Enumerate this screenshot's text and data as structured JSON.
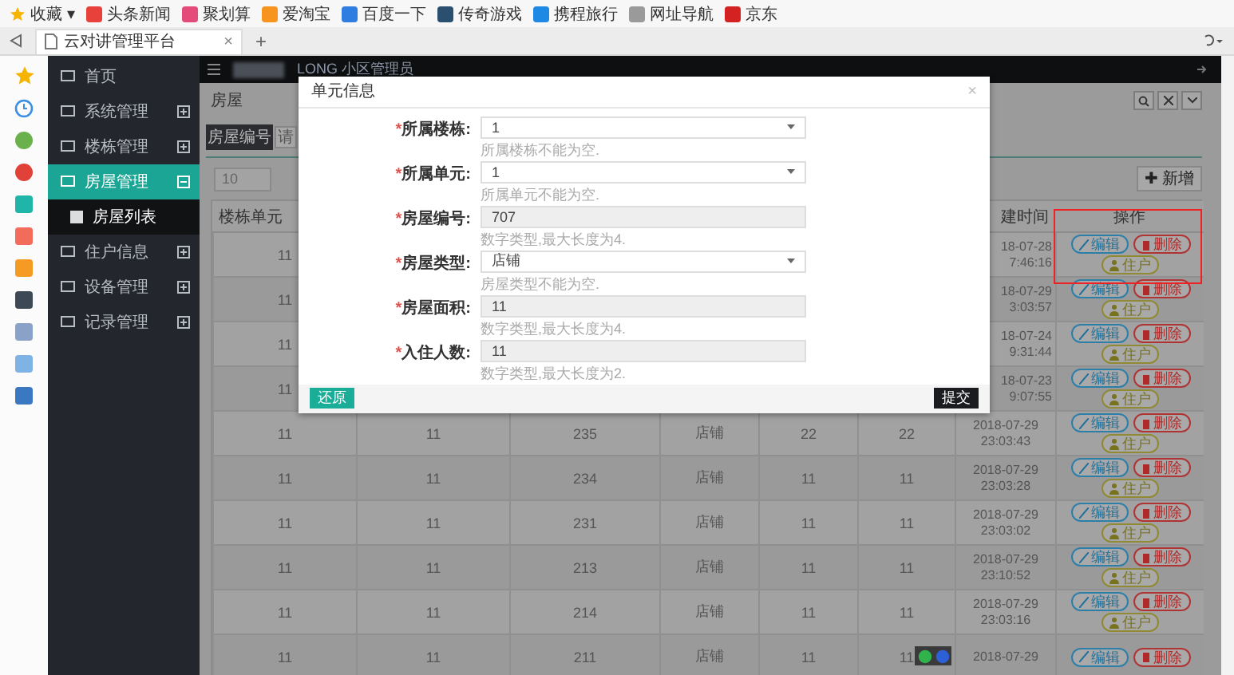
{
  "bookmarks": {
    "favorites": {
      "label": "收藏",
      "caret": "▾"
    },
    "items": [
      {
        "label": "头条新闻",
        "color": "#e8403a"
      },
      {
        "label": "聚划算",
        "color": "#e54b7a"
      },
      {
        "label": "爱淘宝",
        "color": "#f7941d"
      },
      {
        "label": "百度一下",
        "color": "#2f7de1"
      },
      {
        "label": "传奇游戏",
        "color": "#2b4f6e"
      },
      {
        "label": "携程旅行",
        "color": "#1e88e5"
      },
      {
        "label": "网址导航",
        "color": "#9a9a9a"
      },
      {
        "label": "京东",
        "color": "#d42222"
      }
    ]
  },
  "browser_tab": {
    "title": "云对讲管理平台",
    "close": "×",
    "new_tab": "+"
  },
  "app_sidebar": {
    "items": [
      {
        "label": "首页",
        "kind": "link",
        "selected": false
      },
      {
        "label": "系统管理",
        "kind": "group",
        "selected": false,
        "expanded": false
      },
      {
        "label": "楼栋管理",
        "kind": "group",
        "selected": false,
        "expanded": false
      },
      {
        "label": "房屋管理",
        "kind": "group",
        "selected": true,
        "expanded": true,
        "children": [
          {
            "label": "房屋列表",
            "selected": false
          }
        ]
      },
      {
        "label": "住户信息",
        "kind": "group",
        "selected": false,
        "expanded": false
      },
      {
        "label": "设备管理",
        "kind": "group",
        "selected": false,
        "expanded": false
      },
      {
        "label": "记录管理",
        "kind": "group",
        "selected": false,
        "expanded": false
      }
    ]
  },
  "top_bar": {
    "user_role": "LONG  小区管理员"
  },
  "page": {
    "title": "房屋",
    "search_label": "房屋编号",
    "search_placeholder": "请",
    "page_size": "10",
    "add_button": "✚ 新增"
  },
  "table": {
    "header": {
      "column_1": "楼栋单元",
      "column_7": "建时间",
      "column_8": "操作"
    },
    "rows": [
      {
        "kind": "covered",
        "cells": {
          "column_1": "11",
          "column_7": [
            "18-07-28",
            "7:46:16"
          ]
        },
        "actions": [
          {
            "kind": "edit",
            "label": "编辑"
          },
          {
            "kind": "delete",
            "label": "删除"
          },
          {
            "kind": "tenant",
            "label": "住户"
          }
        ]
      },
      {
        "kind": "covered",
        "cells": {
          "column_1": "11",
          "column_7": [
            "18-07-29",
            "3:03:57"
          ]
        },
        "actions": [
          {
            "kind": "edit",
            "label": "编辑"
          },
          {
            "kind": "delete",
            "label": "删除"
          },
          {
            "kind": "tenant",
            "label": "住户"
          }
        ]
      },
      {
        "kind": "covered",
        "cells": {
          "column_1": "11",
          "column_7": [
            "18-07-24",
            "9:31:44"
          ]
        },
        "actions": [
          {
            "kind": "edit",
            "label": "编辑"
          },
          {
            "kind": "delete",
            "label": "删除"
          },
          {
            "kind": "tenant",
            "label": "住户"
          }
        ]
      },
      {
        "kind": "covered",
        "cells": {
          "column_1": "11",
          "column_7": [
            "18-07-23",
            "9:07:55"
          ]
        },
        "actions": [
          {
            "kind": "edit",
            "label": "编辑"
          },
          {
            "kind": "delete",
            "label": "删除"
          },
          {
            "kind": "tenant",
            "label": "住户"
          }
        ]
      },
      {
        "kind": "full",
        "cells": {
          "column_1": "11",
          "column_2": "11",
          "column_3": "235",
          "column_4": "店铺",
          "column_5": "22",
          "column_6": "22",
          "column_7": [
            "2018-07-29",
            "23:03:43"
          ]
        },
        "actions": [
          {
            "kind": "edit",
            "label": "编辑"
          },
          {
            "kind": "delete",
            "label": "删除"
          },
          {
            "kind": "tenant",
            "label": "住户"
          }
        ]
      },
      {
        "kind": "full",
        "cells": {
          "column_1": "11",
          "column_2": "11",
          "column_3": "234",
          "column_4": "店铺",
          "column_5": "11",
          "column_6": "11",
          "column_7": [
            "2018-07-29",
            "23:03:28"
          ]
        },
        "actions": [
          {
            "kind": "edit",
            "label": "编辑"
          },
          {
            "kind": "delete",
            "label": "删除"
          },
          {
            "kind": "tenant",
            "label": "住户"
          }
        ]
      },
      {
        "kind": "full",
        "cells": {
          "column_1": "11",
          "column_2": "11",
          "column_3": "231",
          "column_4": "店铺",
          "column_5": "11",
          "column_6": "11",
          "column_7": [
            "2018-07-29",
            "23:03:02"
          ]
        },
        "actions": [
          {
            "kind": "edit",
            "label": "编辑"
          },
          {
            "kind": "delete",
            "label": "删除"
          },
          {
            "kind": "tenant",
            "label": "住户"
          }
        ]
      },
      {
        "kind": "full",
        "cells": {
          "column_1": "11",
          "column_2": "11",
          "column_3": "213",
          "column_4": "店铺",
          "column_5": "11",
          "column_6": "11",
          "column_7": [
            "2018-07-29",
            "23:10:52"
          ]
        },
        "actions": [
          {
            "kind": "edit",
            "label": "编辑"
          },
          {
            "kind": "delete",
            "label": "删除"
          },
          {
            "kind": "tenant",
            "label": "住户"
          }
        ]
      },
      {
        "kind": "full",
        "cells": {
          "column_1": "11",
          "column_2": "11",
          "column_3": "214",
          "column_4": "店铺",
          "column_5": "11",
          "column_6": "11",
          "column_7": [
            "2018-07-29",
            "23:03:16"
          ]
        },
        "actions": [
          {
            "kind": "edit",
            "label": "编辑"
          },
          {
            "kind": "delete",
            "label": "删除"
          },
          {
            "kind": "tenant",
            "label": "住户"
          }
        ]
      },
      {
        "kind": "full",
        "cells": {
          "column_1": "11",
          "column_2": "11",
          "column_3": "211",
          "column_4": "店铺",
          "column_5": "11",
          "column_6": "11",
          "column_7": [
            "2018-07-29"
          ]
        },
        "actions": [
          {
            "kind": "edit",
            "label": "编辑"
          },
          {
            "kind": "delete",
            "label": "删除"
          }
        ]
      }
    ]
  },
  "modal": {
    "title": "单元信息",
    "close": "×",
    "fields": [
      {
        "kind": "select",
        "mark": "*",
        "label": "所属楼栋:",
        "value": "1",
        "hint": "所属楼栋不能为空."
      },
      {
        "kind": "select",
        "mark": "*",
        "label": "所属单元:",
        "value": "1",
        "hint": "所属单元不能为空."
      },
      {
        "kind": "input",
        "mark": "*",
        "label": "房屋编号:",
        "value": "707",
        "hint": "数字类型,最大长度为4."
      },
      {
        "kind": "select",
        "mark": "*",
        "label": "房屋类型:",
        "value": "店铺",
        "hint": "房屋类型不能为空."
      },
      {
        "kind": "input",
        "mark": "*",
        "label": "房屋面积:",
        "value": "11",
        "hint": "数字类型,最大长度为4."
      },
      {
        "kind": "input",
        "mark": "*",
        "label": "入住人数:",
        "value": "11",
        "hint": "数字类型,最大长度为2."
      }
    ],
    "reset_button": "还原",
    "submit_button": "提交"
  }
}
